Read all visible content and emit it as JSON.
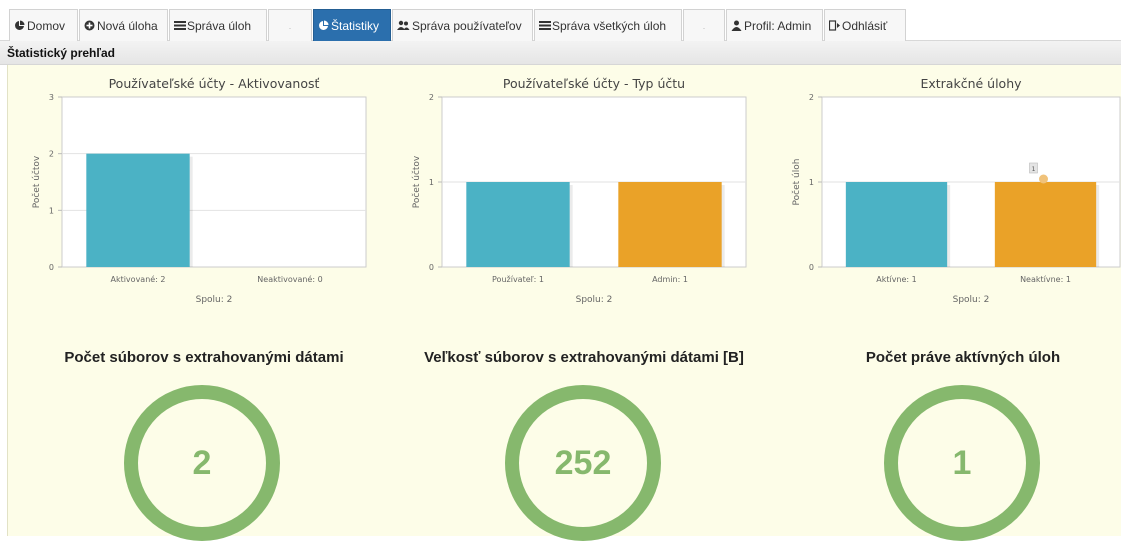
{
  "tabs": [
    {
      "label": "Domov",
      "icon": "pie-chart-icon",
      "active": false
    },
    {
      "label": "Nová úloha",
      "icon": "plus-circle-icon",
      "active": false
    },
    {
      "label": "Správa úloh",
      "icon": "list-icon",
      "active": false
    },
    {
      "label": ".",
      "icon": "",
      "active": false
    },
    {
      "label": "Štatistiky",
      "icon": "pie-chart-icon",
      "active": true
    },
    {
      "label": "Správa používateľov",
      "icon": "users-icon",
      "active": false
    },
    {
      "label": "Správa všetkých úloh",
      "icon": "list-icon",
      "active": false
    },
    {
      "label": ".",
      "icon": "",
      "active": false
    },
    {
      "label": "Profil: Admin",
      "icon": "user-icon",
      "active": false
    },
    {
      "label": "Odhlásiť",
      "icon": "logout-icon",
      "active": false
    }
  ],
  "section": {
    "title": "Štatistický prehľad"
  },
  "chart_data": [
    {
      "type": "bar",
      "title": "Používateľské účty - Aktivovanosť",
      "ylabel": "Počet účtov",
      "xlabel": "Spolu: 2",
      "ylim": [
        0,
        3
      ],
      "yticks": [
        0,
        1,
        2,
        3
      ],
      "categories": [
        "Aktivované: 2",
        "Neaktivované: 0"
      ],
      "values": [
        2,
        0
      ],
      "colors": [
        "#4bb2c5",
        "#eaa228"
      ]
    },
    {
      "type": "bar",
      "title": "Používateľské účty - Typ účtu",
      "ylabel": "Počet účtov",
      "xlabel": "Spolu: 2",
      "ylim": [
        0,
        2
      ],
      "yticks": [
        0,
        1,
        2
      ],
      "categories": [
        "Používateľ: 1",
        "Admin: 1"
      ],
      "values": [
        1,
        1
      ],
      "colors": [
        "#4bb2c5",
        "#eaa228"
      ]
    },
    {
      "type": "bar",
      "title": "Extrakčné úlohy",
      "ylabel": "Počet úloh",
      "xlabel": "Spolu: 2",
      "ylim": [
        0,
        2
      ],
      "yticks": [
        0,
        1,
        2
      ],
      "categories": [
        "Aktívne: 1",
        "Neaktívne: 1"
      ],
      "values": [
        1,
        1
      ],
      "colors": [
        "#4bb2c5",
        "#eaa228"
      ],
      "tooltip": "1"
    }
  ],
  "stats": [
    {
      "title": "Počet súborov s extrahovanými dátami",
      "value": "2"
    },
    {
      "title": "Veľkosť súborov s extrahovanými dátami [B]",
      "value": "252"
    },
    {
      "title": "Počet práve aktívných úloh",
      "value": "1"
    }
  ],
  "colors": {
    "active_tab": "#2b6fad",
    "ring": "#86b86d",
    "background": "#fdfde8"
  }
}
